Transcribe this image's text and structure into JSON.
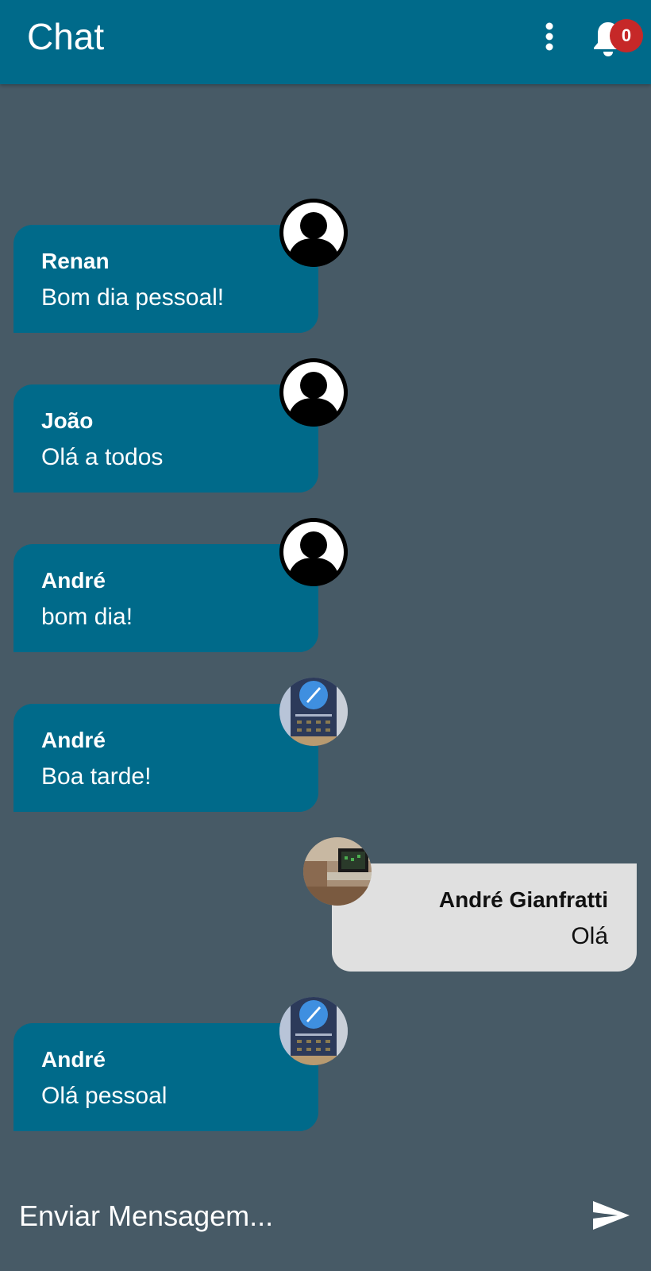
{
  "appbar": {
    "title": "Chat",
    "menu_icon": "more-vert-icon",
    "notifications_icon": "bell-icon",
    "notification_count": "0"
  },
  "colors": {
    "appbar": "#006a8a",
    "background": "#475a66",
    "bubble_other": "#006a8a",
    "bubble_mine": "#e0e0e0",
    "badge": "#c62828"
  },
  "messages": [
    {
      "sender": "Renan",
      "text": "Bom dia pessoal!",
      "mine": false,
      "avatar": "default-user-avatar"
    },
    {
      "sender": "João",
      "text": "Olá a todos",
      "mine": false,
      "avatar": "default-user-avatar"
    },
    {
      "sender": "André",
      "text": "bom dia!",
      "mine": false,
      "avatar": "default-user-avatar"
    },
    {
      "sender": "André",
      "text": "Boa tarde!",
      "mine": false,
      "avatar": "photo-avatar"
    },
    {
      "sender": "André Gianfratti",
      "text": "Olá",
      "mine": true,
      "avatar": "photo-avatar"
    },
    {
      "sender": "André",
      "text": "Olá pessoal",
      "mine": false,
      "avatar": "photo-avatar"
    }
  ],
  "composer": {
    "placeholder": "Enviar Mensagem...",
    "send_icon": "send-icon"
  }
}
